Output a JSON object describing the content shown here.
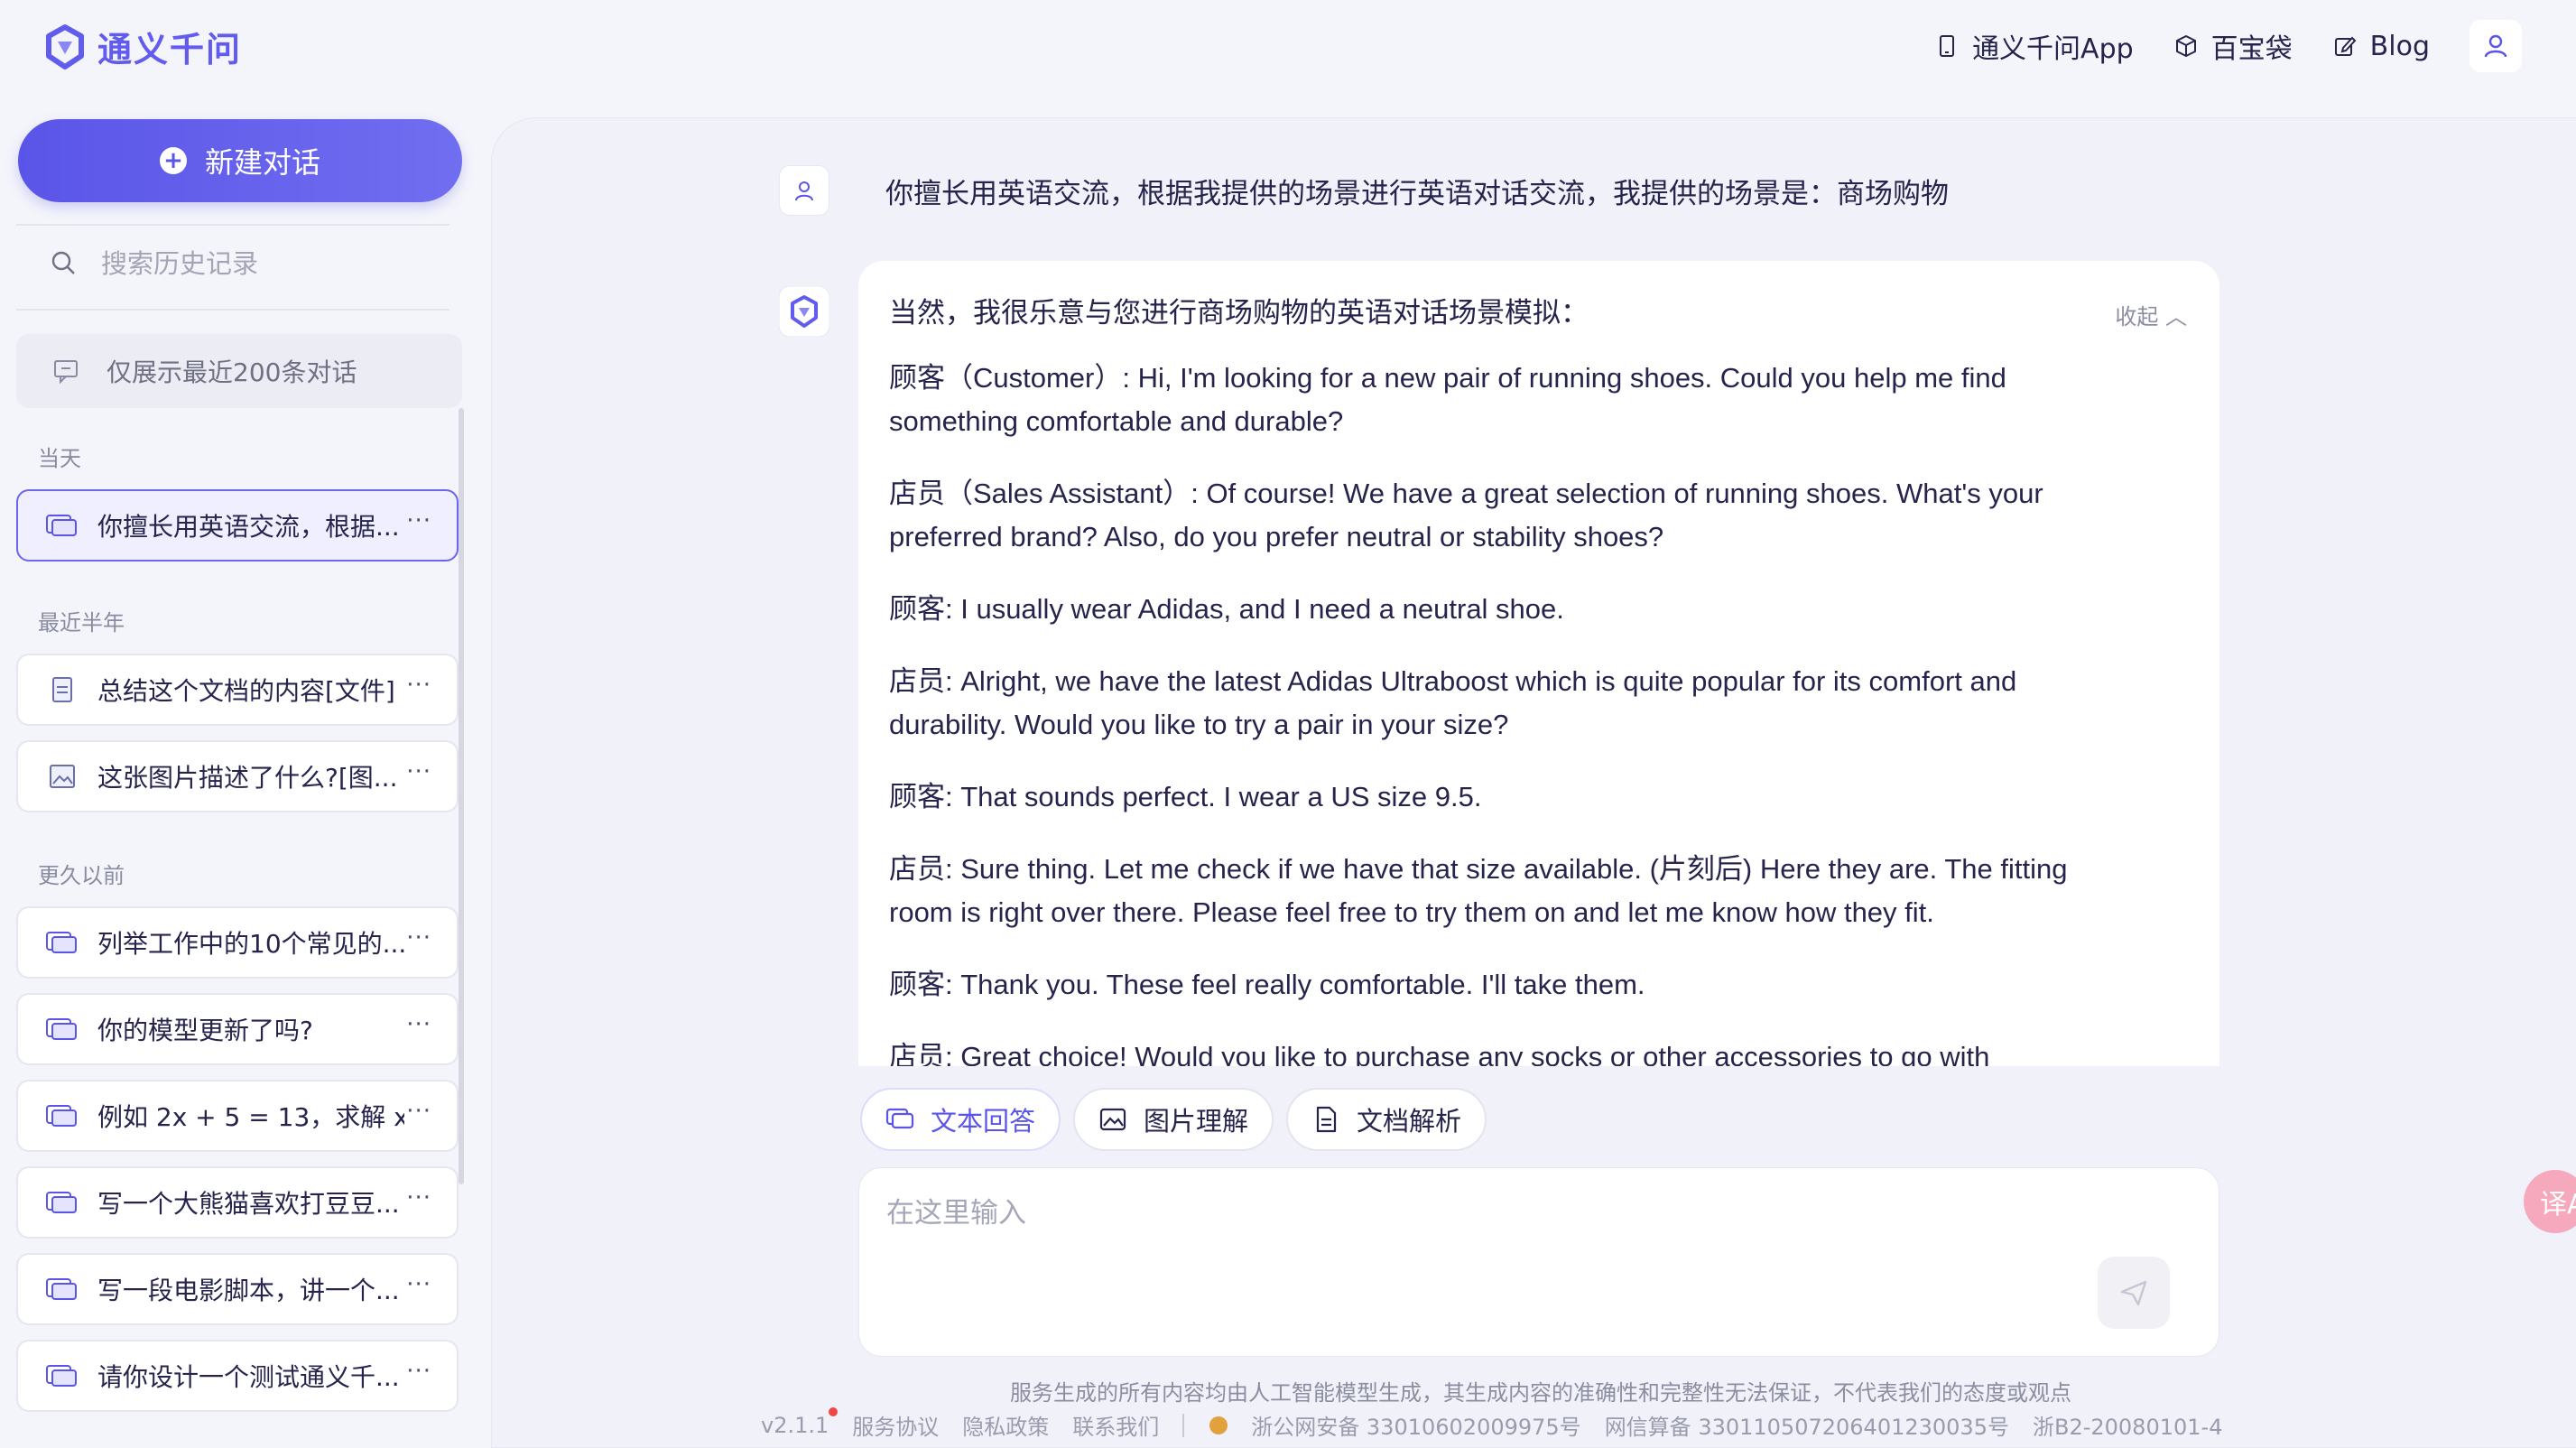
{
  "brand": {
    "name": "通义千问",
    "color": "#615ced"
  },
  "topnav": {
    "app": "通义千问App",
    "baibao": "百宝袋",
    "blog": "Blog"
  },
  "sidebar": {
    "new_chat": "新建对话",
    "search_placeholder": "搜索历史记录",
    "limit_note": "仅展示最近200条对话",
    "groups": {
      "today": "当天",
      "half_year": "最近半年",
      "earlier": "更久以前"
    },
    "items": [
      {
        "label": "你擅长用英语交流，根据...",
        "icon": "chat-icon",
        "active": true
      },
      {
        "label": "总结这个文档的内容[文件]",
        "icon": "document-icon"
      },
      {
        "label": "这张图片描述了什么?[图...",
        "icon": "image-icon"
      },
      {
        "label": "列举工作中的10个常见的...",
        "icon": "chat-icon"
      },
      {
        "label": "你的模型更新了吗?",
        "icon": "chat-icon"
      },
      {
        "label": "例如 2x + 5 = 13，求解 x",
        "icon": "chat-icon"
      },
      {
        "label": "写一个大熊猫喜欢打豆豆...",
        "icon": "chat-icon"
      },
      {
        "label": "写一段电影脚本，讲一个...",
        "icon": "chat-icon"
      },
      {
        "label": "请你设计一个测试通义千...",
        "icon": "chat-icon"
      }
    ],
    "more": "···"
  },
  "chat": {
    "user_message": "你擅长用英语交流，根据我提供的场景进行英语对话交流，我提供的场景是：商场购物",
    "collapse": "收起 ︿",
    "answer": [
      "当然，我很乐意与您进行商场购物的英语对话场景模拟：",
      "顾客（Customer）: Hi, I'm looking for a new pair of running shoes. Could you help me find something comfortable and durable?",
      "店员（Sales Assistant）: Of course! We have a great selection of running shoes. What's your preferred brand? Also, do you prefer neutral or stability shoes?",
      "顾客: I usually wear Adidas, and I need a neutral shoe.",
      "店员: Alright, we have the latest Adidas Ultraboost which is quite popular for its comfort and durability. Would you like to try a pair in your size?",
      "顾客: That sounds perfect. I wear a US size 9.5.",
      "店员: Sure thing. Let me check if we have that size available. (片刻后) Here they are. The fitting room is right over there. Please feel free to try them on and let me know how they fit.",
      "顾客: Thank you. These feel really comfortable. I'll take them.",
      "店员: Great choice! Would you like to purchase any socks or other accessories to go with"
    ]
  },
  "tools": [
    {
      "label": "文本回答",
      "active": true
    },
    {
      "label": "图片理解"
    },
    {
      "label": "文档解析"
    }
  ],
  "input": {
    "placeholder": "在这里输入"
  },
  "footer": {
    "disclaimer": "服务生成的所有内容均由人工智能模型生成，其生成内容的准确性和完整性无法保证，不代表我们的态度或观点",
    "version": "v2.1.1",
    "terms": "服务协议",
    "privacy": "隐私政策",
    "contact": "联系我们",
    "police": "浙公网安备 33010602009975号",
    "netcert": "网信算备 330110507206401230035号",
    "icp": "浙B2-20080101-4"
  },
  "float": {
    "label": "译A"
  }
}
